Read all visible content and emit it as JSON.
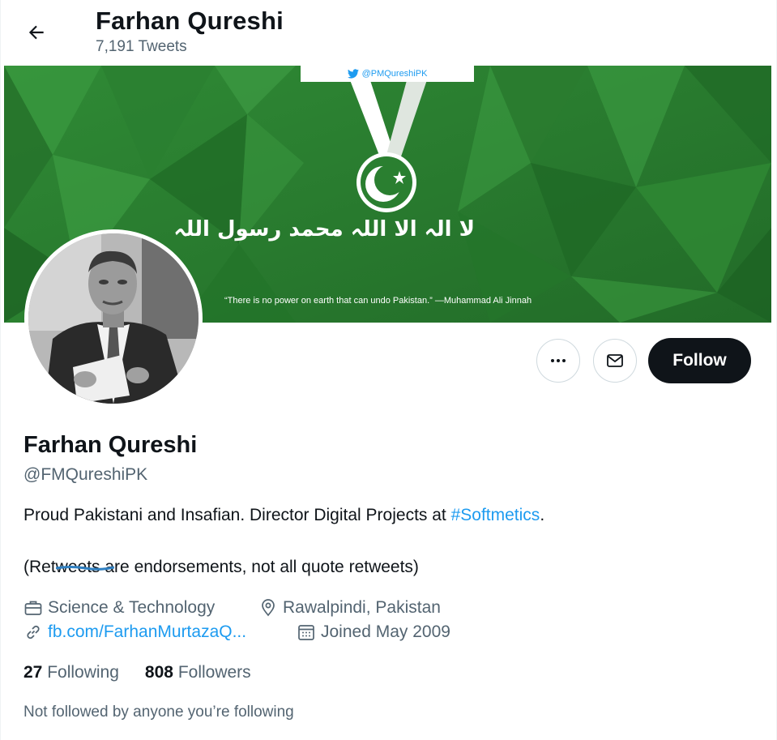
{
  "header": {
    "title": "Farhan Qureshi",
    "tweet_count": "7,191 Tweets"
  },
  "banner": {
    "handle": "@PMQureshiPK",
    "quote": "“There is no power on earth that can undo Pakistan.” —Muhammad Ali Jinnah",
    "calligraphy": "لا الہ الا اللہ محمد رسول اللہ",
    "colors": {
      "green_dark": "#1f6b26",
      "green_mid": "#2e7d32",
      "green_light": "#43a047"
    }
  },
  "profile": {
    "name": "Farhan Qureshi",
    "handle": "@FMQureshiPK",
    "bio_line1_pre": "Proud Pakistani and Insafian. Director Digital Projects at ",
    "bio_hashtag": "#Softmetics",
    "bio_line1_post": ".",
    "bio_line2_a": "(Re",
    "bio_line2_struck": "tweets",
    "bio_line2_b": " are endorsements, not all quote retweets)",
    "category": "Science & Technology",
    "location": "Rawalpindi, Pakistan",
    "website": "fb.com/FarhanMurtazaQ...",
    "joined": "Joined May 2009",
    "following_count": "27",
    "following_label": "Following",
    "followers_count": "808",
    "followers_label": "Followers",
    "not_followed": "Not followed by anyone you’re following"
  },
  "actions": {
    "follow_label": "Follow"
  },
  "icons": {
    "back": "arrow-left-icon",
    "more": "more-horizontal-icon",
    "message": "envelope-icon",
    "category": "briefcase-icon",
    "location": "map-pin-icon",
    "link": "link-icon",
    "joined": "calendar-icon",
    "twitter": "twitter-bird-icon"
  },
  "colors": {
    "accent": "#1d9bf0",
    "text_primary": "#0f1419",
    "text_secondary": "#536471",
    "follow_button_bg": "#0f1419"
  }
}
